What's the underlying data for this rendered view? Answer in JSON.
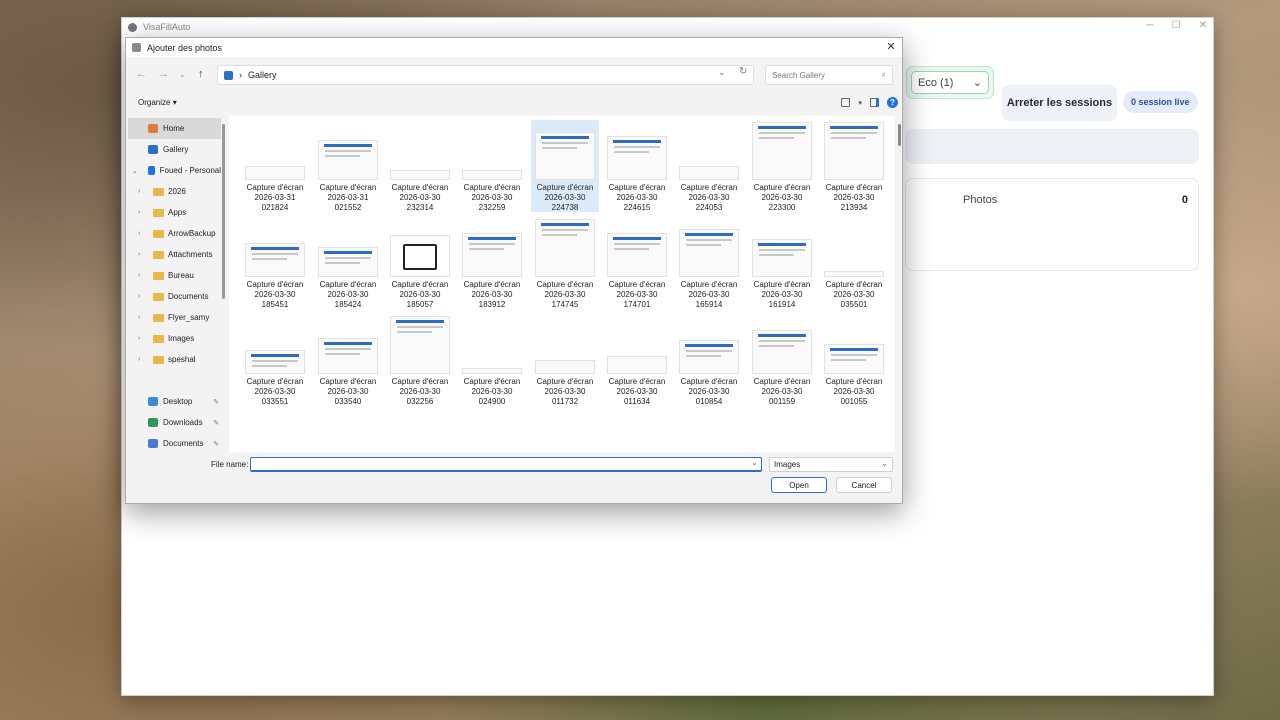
{
  "app": {
    "title": "VisaFillAuto",
    "mode_select": "Eco (1)",
    "stop_button": "Arreter les sessions",
    "session_badge": "0 session live",
    "photos_label": "Photos",
    "photos_count": "0"
  },
  "dialog": {
    "title": "Ajouter des photos",
    "breadcrumb": "Gallery",
    "search_placeholder": "Search Gallery",
    "organize": "Organize",
    "file_name_label": "File name:",
    "file_name_value": "",
    "filter": "Images",
    "open": "Open",
    "cancel": "Cancel"
  },
  "sidebar": [
    {
      "label": "Home",
      "icon": "home-icon",
      "selected": true
    },
    {
      "label": "Gallery",
      "icon": "gallery-icon"
    },
    {
      "label": "Foued - Personal",
      "icon": "onedrive-icon",
      "expanded": true
    },
    {
      "label": "2026",
      "icon": "folder-icon"
    },
    {
      "label": "Apps",
      "icon": "folder-icon"
    },
    {
      "label": "ArrowBackup",
      "icon": "folder-icon"
    },
    {
      "label": "Attachments",
      "icon": "folder-icon"
    },
    {
      "label": "Bureau",
      "icon": "folder-icon"
    },
    {
      "label": "Documents",
      "icon": "folder-icon"
    },
    {
      "label": "Flyer_samy",
      "icon": "folder-icon"
    },
    {
      "label": "Images",
      "icon": "folder-icon"
    },
    {
      "label": "speshal",
      "icon": "folder-icon"
    },
    {
      "label": "Desktop",
      "icon": "desktop-icon",
      "pinned": true
    },
    {
      "label": "Downloads",
      "icon": "download-icon",
      "pinned": true
    },
    {
      "label": "Documents",
      "icon": "documents-icon",
      "pinned": true
    }
  ],
  "files": [
    {
      "l1": "Capture d'écran",
      "l2": "2026-03-31",
      "l3": "021824"
    },
    {
      "l1": "Capture d'écran",
      "l2": "2026-03-31",
      "l3": "021552"
    },
    {
      "l1": "Capture d'écran",
      "l2": "2026-03-30",
      "l3": "232314"
    },
    {
      "l1": "Capture d'écran",
      "l2": "2026-03-30",
      "l3": "232259"
    },
    {
      "l1": "Capture d'écran",
      "l2": "2026-03-30",
      "l3": "224738",
      "selected": true
    },
    {
      "l1": "Capture d'écran",
      "l2": "2026-03-30",
      "l3": "224615"
    },
    {
      "l1": "Capture d'écran",
      "l2": "2026-03-30",
      "l3": "224053"
    },
    {
      "l1": "Capture d'écran",
      "l2": "2026-03-30",
      "l3": "223300"
    },
    {
      "l1": "Capture d'écran",
      "l2": "2026-03-30",
      "l3": "213934"
    },
    {
      "l1": "Capture d'écran",
      "l2": "2026-03-30",
      "l3": "185451"
    },
    {
      "l1": "Capture d'écran",
      "l2": "2026-03-30",
      "l3": "185424"
    },
    {
      "l1": "Capture d'écran",
      "l2": "2026-03-30",
      "l3": "185057"
    },
    {
      "l1": "Capture d'écran",
      "l2": "2026-03-30",
      "l3": "183912"
    },
    {
      "l1": "Capture d'écran",
      "l2": "2026-03-30",
      "l3": "174745"
    },
    {
      "l1": "Capture d'écran",
      "l2": "2026-03-30",
      "l3": "174701"
    },
    {
      "l1": "Capture d'écran",
      "l2": "2026-03-30",
      "l3": "165914"
    },
    {
      "l1": "Capture d'écran",
      "l2": "2026-03-30",
      "l3": "161914"
    },
    {
      "l1": "Capture d'écran",
      "l2": "2026-03-30",
      "l3": "035501"
    },
    {
      "l1": "Capture d'écran",
      "l2": "2026-03-30",
      "l3": "033551"
    },
    {
      "l1": "Capture d'écran",
      "l2": "2026-03-30",
      "l3": "033540"
    },
    {
      "l1": "Capture d'écran",
      "l2": "2026-03-30",
      "l3": "032256"
    },
    {
      "l1": "Capture d'écran",
      "l2": "2026-03-30",
      "l3": "024900"
    },
    {
      "l1": "Capture d'écran",
      "l2": "2026-03-30",
      "l3": "011732"
    },
    {
      "l1": "Capture d'écran",
      "l2": "2026-03-30",
      "l3": "011634"
    },
    {
      "l1": "Capture d'écran",
      "l2": "2026-03-30",
      "l3": "010854"
    },
    {
      "l1": "Capture d'écran",
      "l2": "2026-03-30",
      "l3": "001159"
    },
    {
      "l1": "Capture d'écran",
      "l2": "2026-03-30",
      "l3": "001055"
    }
  ]
}
